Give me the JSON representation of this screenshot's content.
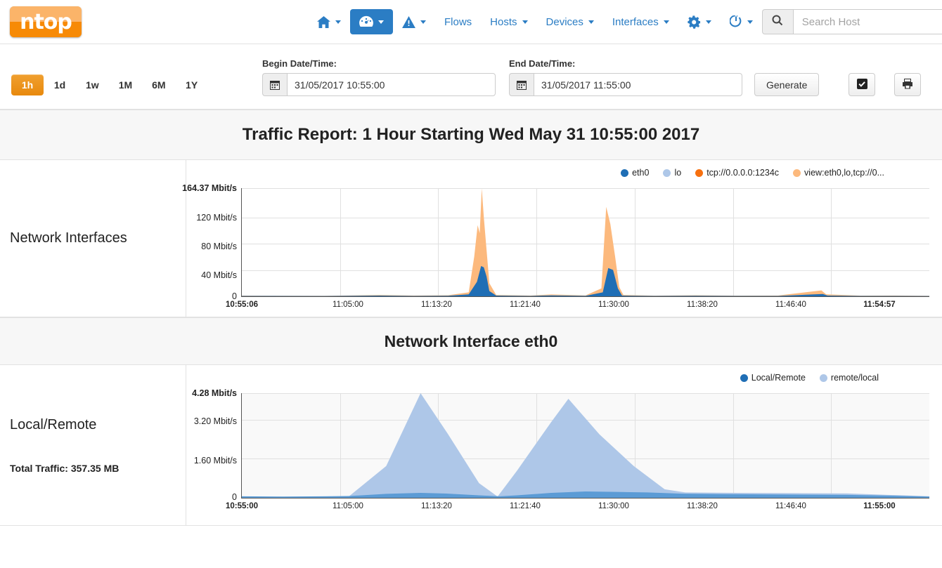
{
  "header": {
    "logo_text": "ntop",
    "nav": [
      {
        "name": "home",
        "icon": "home-icon",
        "label": "",
        "caret": true,
        "active": false
      },
      {
        "name": "dashboard",
        "icon": "gauge-icon",
        "label": "",
        "caret": true,
        "active": true
      },
      {
        "name": "alerts",
        "icon": "warning-triangle-icon",
        "label": "",
        "caret": true,
        "active": false
      },
      {
        "name": "flows",
        "icon": "",
        "label": "Flows",
        "caret": false,
        "active": false
      },
      {
        "name": "hosts",
        "icon": "",
        "label": "Hosts",
        "caret": true,
        "active": false
      },
      {
        "name": "devices",
        "icon": "",
        "label": "Devices",
        "caret": true,
        "active": false
      },
      {
        "name": "interfaces",
        "icon": "",
        "label": "Interfaces",
        "caret": true,
        "active": false
      },
      {
        "name": "settings",
        "icon": "gear-icon",
        "label": "",
        "caret": true,
        "active": false
      },
      {
        "name": "power",
        "icon": "power-icon",
        "label": "",
        "caret": true,
        "active": false
      }
    ],
    "search": {
      "placeholder": "Search Host",
      "value": "",
      "icon": "search-icon"
    }
  },
  "toolbar": {
    "ranges": [
      {
        "label": "1h",
        "active": true
      },
      {
        "label": "1d",
        "active": false
      },
      {
        "label": "1w",
        "active": false
      },
      {
        "label": "1M",
        "active": false
      },
      {
        "label": "6M",
        "active": false
      },
      {
        "label": "1Y",
        "active": false
      }
    ],
    "begin_label": "Begin Date/Time:",
    "begin_value": "31/05/2017 10:55:00",
    "end_label": "End Date/Time:",
    "end_value": "31/05/2017 11:55:00",
    "generate_label": "Generate",
    "checkbox_icon": "checkbox-checked-icon",
    "print_icon": "printer-icon",
    "calendar_icon": "calendar-icon"
  },
  "report": {
    "title": "Traffic Report: 1 Hour Starting Wed May 31 10:55:00 2017",
    "section1_side_title": "Network Interfaces",
    "section2_band_title": "Network Interface eth0",
    "section2_side_title": "Local/Remote",
    "section2_total_traffic": "Total Traffic: 357.35 MB"
  },
  "colors": {
    "dark_blue": "#1f6eb5",
    "light_blue": "#aec7e8",
    "orange": "#f7700f",
    "light_orange": "#fcb97d",
    "accent_orange": "#e8890d",
    "nav_blue": "#2b7dc4"
  },
  "chart_data": [
    {
      "type": "area",
      "name": "network-interfaces-chart",
      "title": "",
      "xlabel": "",
      "ylabel": "Mbit/s",
      "ylim": [
        0,
        164.37
      ],
      "ytick_labels": [
        "0",
        "40 Mbit/s",
        "80 Mbit/s",
        "120 Mbit/s",
        "164.37 Mbit/s"
      ],
      "ytick_values": [
        0,
        40,
        80,
        120,
        164.37
      ],
      "xtick_labels": [
        "10:55:06",
        "11:05:00",
        "11:13:20",
        "11:21:40",
        "11:30:00",
        "11:38:20",
        "11:46:40",
        "11:54:57"
      ],
      "grid": true,
      "legend_position": "top-right",
      "legend": [
        {
          "label": "eth0",
          "color": "#1f6eb5"
        },
        {
          "label": "lo",
          "color": "#aec7e8"
        },
        {
          "label": "tcp://0.0.0.0:1234c",
          "color": "#f7700f"
        },
        {
          "label": "view:eth0,lo,tcp://0...",
          "color": "#fcb97d"
        }
      ],
      "series": [
        {
          "name": "eth0",
          "color": "#1f6eb5",
          "points": [
            [
              0.0,
              0.5
            ],
            [
              0.12,
              0.4
            ],
            [
              0.2,
              1.0
            ],
            [
              0.25,
              0.6
            ],
            [
              0.3,
              0.8
            ],
            [
              0.33,
              3.0
            ],
            [
              0.342,
              22.0
            ],
            [
              0.348,
              46.0
            ],
            [
              0.352,
              44.0
            ],
            [
              0.356,
              30.0
            ],
            [
              0.36,
              8.0
            ],
            [
              0.37,
              1.0
            ],
            [
              0.42,
              0.6
            ],
            [
              0.45,
              1.4
            ],
            [
              0.5,
              0.7
            ],
            [
              0.525,
              6.0
            ],
            [
              0.533,
              43.0
            ],
            [
              0.54,
              40.0
            ],
            [
              0.547,
              12.0
            ],
            [
              0.553,
              1.0
            ],
            [
              0.6,
              0.5
            ],
            [
              0.66,
              0.8
            ],
            [
              0.72,
              0.5
            ],
            [
              0.78,
              0.6
            ],
            [
              0.845,
              3.5
            ],
            [
              0.852,
              1.0
            ],
            [
              0.9,
              0.5
            ],
            [
              0.95,
              0.6
            ],
            [
              1.0,
              0.4
            ]
          ]
        },
        {
          "name": "view:eth0,lo,tcp://0...",
          "color": "#fcb97d",
          "points": [
            [
              0.0,
              1.0
            ],
            [
              0.12,
              0.8
            ],
            [
              0.2,
              2.0
            ],
            [
              0.25,
              1.2
            ],
            [
              0.3,
              1.6
            ],
            [
              0.33,
              6.0
            ],
            [
              0.338,
              60.0
            ],
            [
              0.343,
              108.0
            ],
            [
              0.346,
              96.0
            ],
            [
              0.349,
              164.0
            ],
            [
              0.352,
              120.0
            ],
            [
              0.356,
              70.0
            ],
            [
              0.36,
              20.0
            ],
            [
              0.37,
              2.0
            ],
            [
              0.42,
              1.2
            ],
            [
              0.45,
              2.8
            ],
            [
              0.5,
              1.4
            ],
            [
              0.523,
              12.0
            ],
            [
              0.53,
              136.0
            ],
            [
              0.536,
              110.0
            ],
            [
              0.543,
              60.0
            ],
            [
              0.549,
              14.0
            ],
            [
              0.555,
              2.0
            ],
            [
              0.6,
              1.0
            ],
            [
              0.66,
              1.6
            ],
            [
              0.72,
              1.0
            ],
            [
              0.78,
              1.2
            ],
            [
              0.843,
              9.0
            ],
            [
              0.85,
              3.0
            ],
            [
              0.9,
              1.0
            ],
            [
              0.95,
              1.2
            ],
            [
              1.0,
              0.8
            ]
          ]
        }
      ]
    },
    {
      "type": "area",
      "name": "local-remote-chart",
      "title": "",
      "xlabel": "",
      "ylabel": "Mbit/s",
      "ylim": [
        0,
        4.28
      ],
      "ytick_labels": [
        "0",
        "1.60 Mbit/s",
        "3.20 Mbit/s",
        "4.28 Mbit/s"
      ],
      "ytick_values": [
        0,
        1.6,
        3.2,
        4.28
      ],
      "xtick_labels": [
        "10:55:00",
        "11:05:00",
        "11:13:20",
        "11:21:40",
        "11:30:00",
        "11:38:20",
        "11:46:40",
        "11:55:00"
      ],
      "grid": true,
      "legend_position": "top-right",
      "legend": [
        {
          "label": "Local/Remote",
          "color": "#1f6eb5"
        },
        {
          "label": "remote/local",
          "color": "#aec7e8"
        }
      ],
      "series": [
        {
          "name": "Local/Remote",
          "color": "#5b9bd5",
          "points": [
            [
              0.0,
              0.06
            ],
            [
              0.06,
              0.05
            ],
            [
              0.12,
              0.06
            ],
            [
              0.155,
              0.07
            ],
            [
              0.21,
              0.16
            ],
            [
              0.26,
              0.2
            ],
            [
              0.3,
              0.17
            ],
            [
              0.345,
              0.1
            ],
            [
              0.375,
              0.06
            ],
            [
              0.4,
              0.1
            ],
            [
              0.45,
              0.2
            ],
            [
              0.5,
              0.26
            ],
            [
              0.545,
              0.24
            ],
            [
              0.59,
              0.22
            ],
            [
              0.64,
              0.17
            ],
            [
              0.7,
              0.15
            ],
            [
              0.76,
              0.14
            ],
            [
              0.82,
              0.13
            ],
            [
              0.88,
              0.12
            ],
            [
              0.94,
              0.09
            ],
            [
              1.0,
              0.05
            ]
          ]
        },
        {
          "name": "remote/local",
          "color": "#aec7e8",
          "points": [
            [
              0.0,
              0.03
            ],
            [
              0.12,
              0.03
            ],
            [
              0.155,
              0.04
            ],
            [
              0.21,
              1.3
            ],
            [
              0.26,
              4.28
            ],
            [
              0.3,
              2.6
            ],
            [
              0.345,
              0.6
            ],
            [
              0.372,
              0.05
            ],
            [
              0.4,
              1.1
            ],
            [
              0.45,
              3.1
            ],
            [
              0.475,
              4.05
            ],
            [
              0.52,
              2.6
            ],
            [
              0.57,
              1.3
            ],
            [
              0.615,
              0.35
            ],
            [
              0.645,
              0.22
            ],
            [
              0.72,
              0.2
            ],
            [
              0.8,
              0.19
            ],
            [
              0.88,
              0.18
            ],
            [
              0.94,
              0.12
            ],
            [
              1.0,
              0.06
            ]
          ]
        }
      ]
    }
  ]
}
